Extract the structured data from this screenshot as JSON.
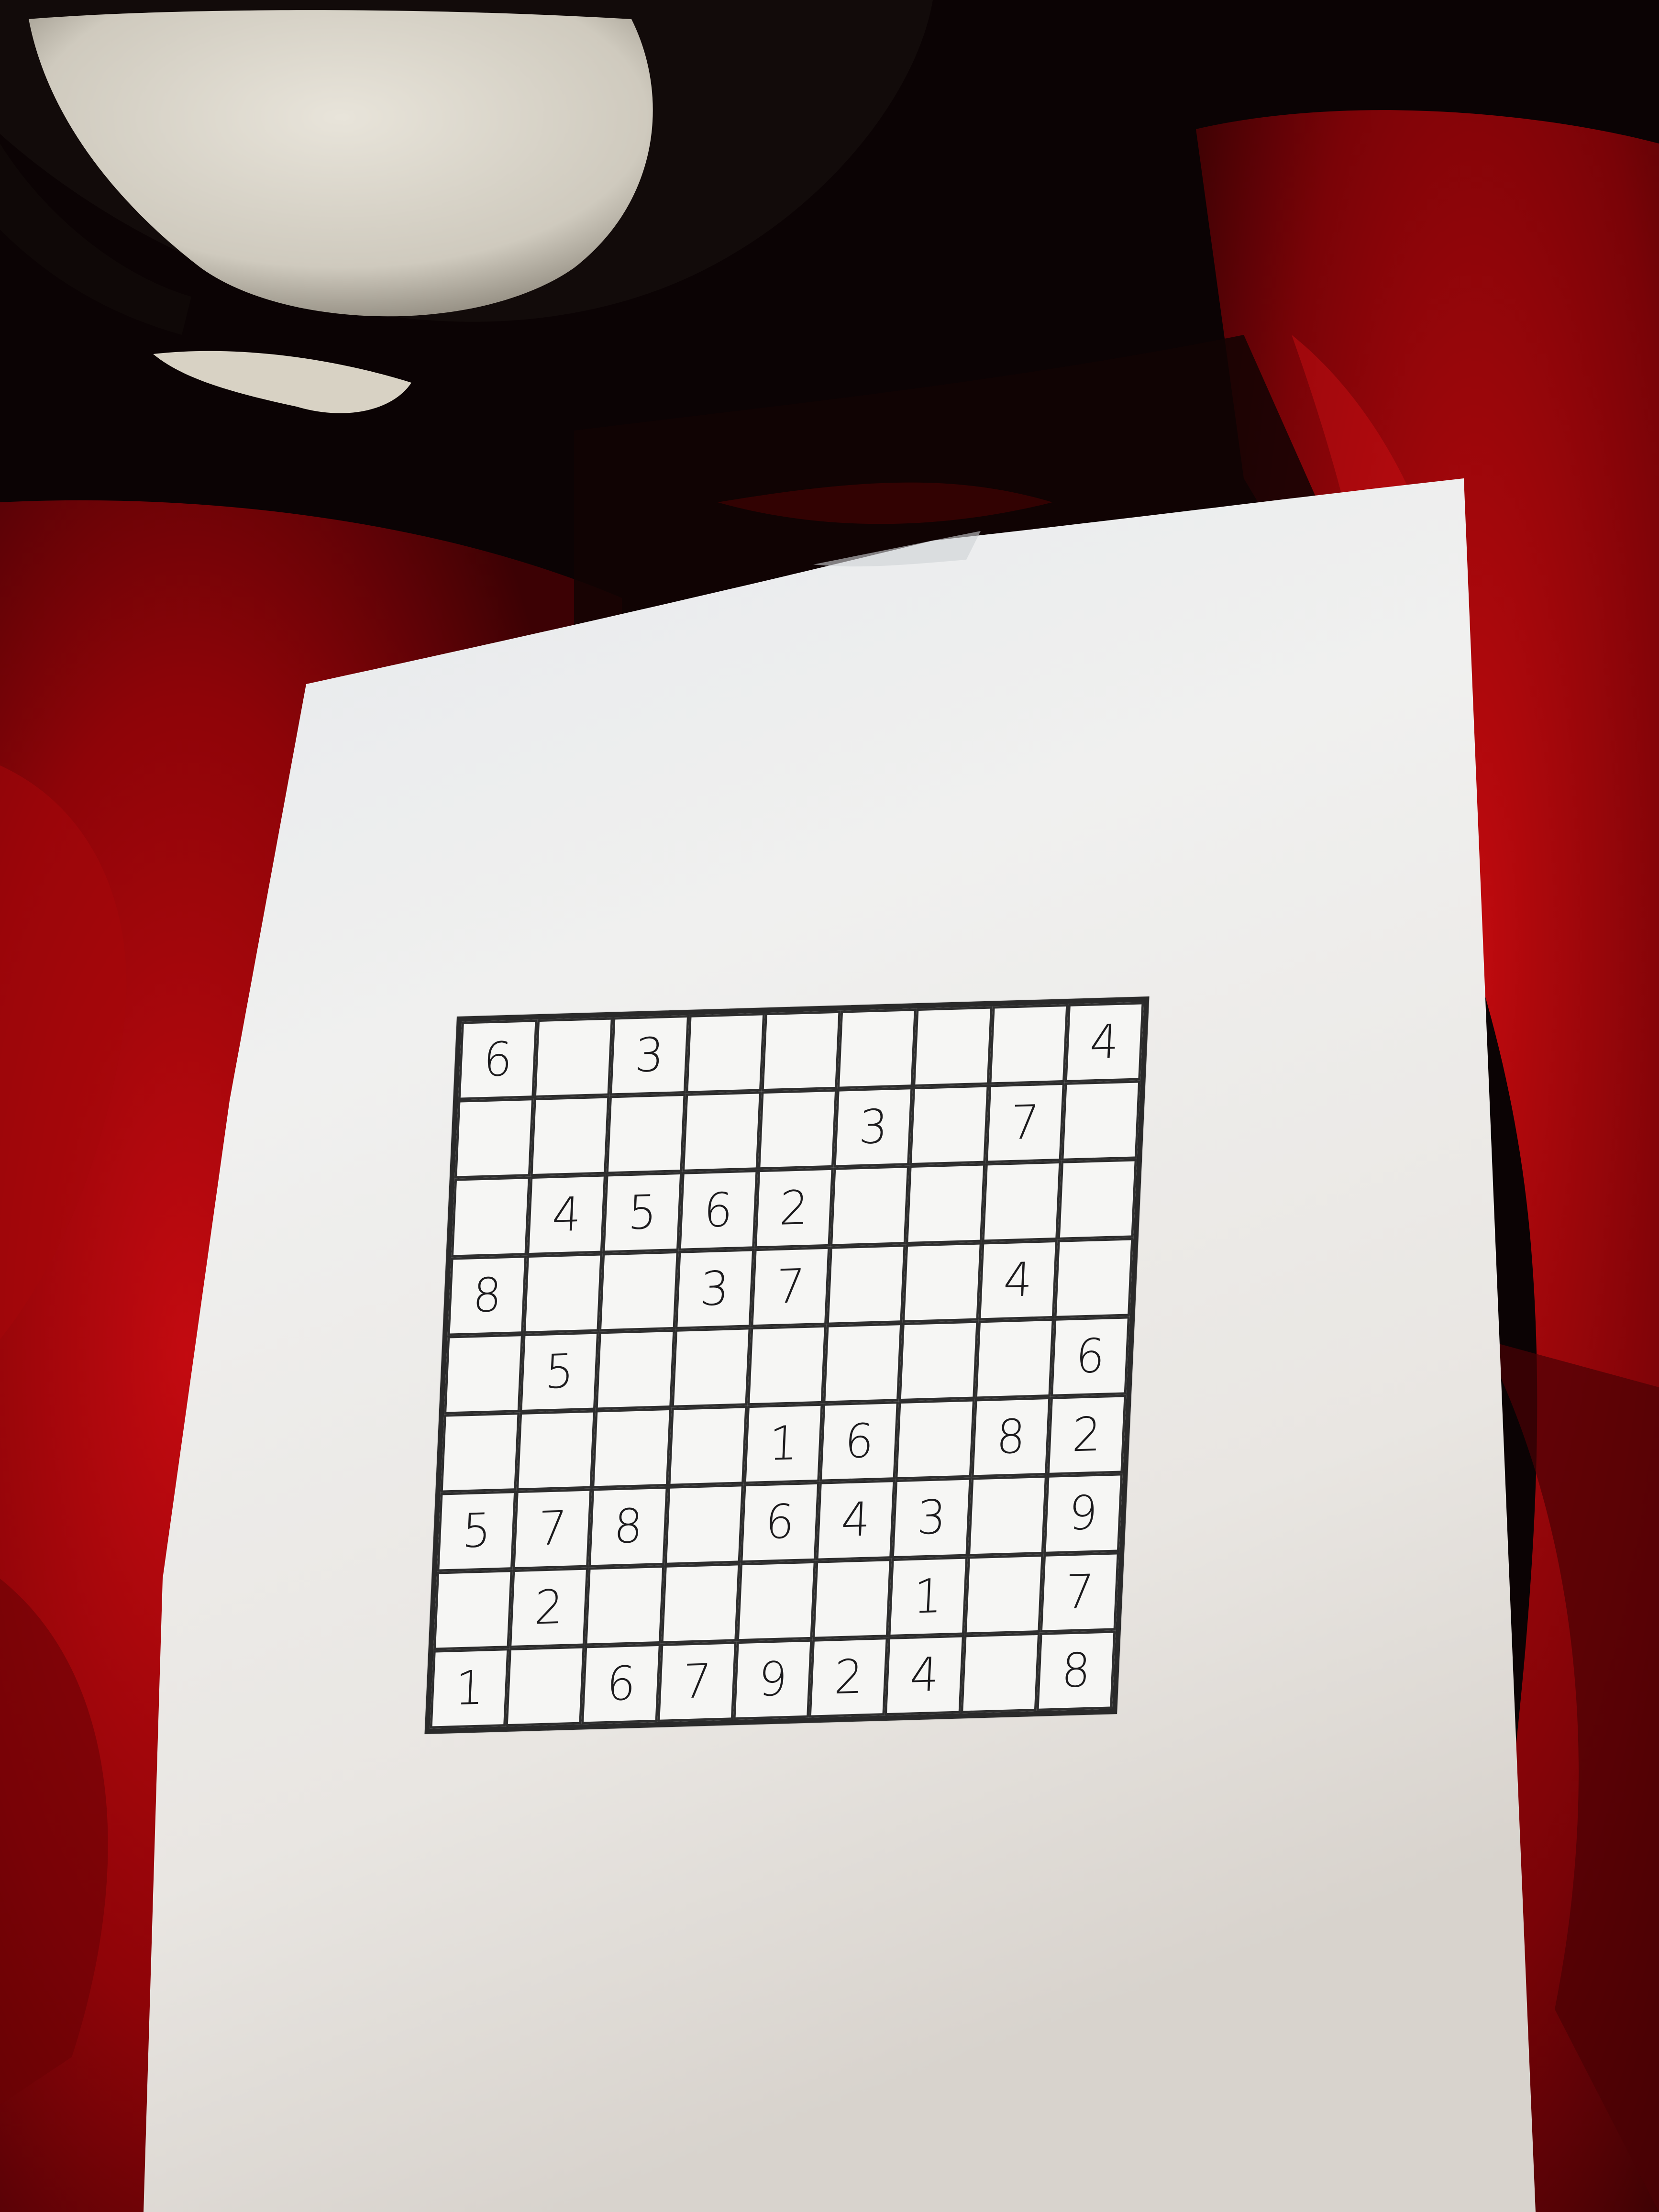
{
  "sudoku": {
    "rows": [
      [
        "6",
        "",
        "3",
        "",
        "",
        "",
        "",
        "",
        "4"
      ],
      [
        "",
        "",
        "",
        "",
        "",
        "3",
        "",
        "7",
        ""
      ],
      [
        "",
        "4",
        "5",
        "6",
        "2",
        "",
        "",
        "",
        ""
      ],
      [
        "8",
        "",
        "",
        "3",
        "7",
        "",
        "",
        "4",
        ""
      ],
      [
        "",
        "5",
        "",
        "",
        "",
        "",
        "",
        "",
        "6"
      ],
      [
        "",
        "",
        "",
        "",
        "1",
        "6",
        "",
        "8",
        "2"
      ],
      [
        "5",
        "7",
        "8",
        "",
        "6",
        "4",
        "3",
        "",
        "9"
      ],
      [
        "",
        "2",
        "",
        "",
        "",
        "",
        "1",
        "",
        "7"
      ],
      [
        "1",
        "",
        "6",
        "7",
        "9",
        "2",
        "4",
        "",
        "8"
      ]
    ]
  },
  "colors": {
    "paper": "#f2f1ef",
    "paper_shadow": "#d9d7d4",
    "grid_line": "#2a2a2a",
    "ink": "#1c1b1d",
    "red_fabric": "#b0080c",
    "dark_red_fabric": "#5a0205",
    "black_fabric": "#0b0304",
    "plush_white": "#dcd8cc"
  },
  "scene": {
    "objects": [
      "plush-toy",
      "red-blanket",
      "paper-sheet",
      "sudoku-grid"
    ]
  }
}
